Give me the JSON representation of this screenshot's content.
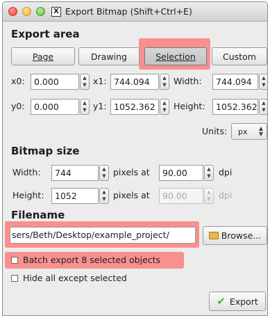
{
  "window": {
    "title": "Export Bitmap (Shift+Ctrl+E)"
  },
  "export_area": {
    "heading": "Export area",
    "buttons": [
      {
        "label": "Page",
        "pressed": false
      },
      {
        "label": "Drawing",
        "pressed": false
      },
      {
        "label": "Selection",
        "pressed": true
      },
      {
        "label": "Custom",
        "pressed": false
      }
    ],
    "x0_label": "x0:",
    "x0_value": "0.000",
    "x1_label": "x1:",
    "x1_value": "744.094",
    "width_label": "Width:",
    "width_value": "744.094",
    "y0_label": "y0:",
    "y0_value": "0.000",
    "y1_label": "y1:",
    "y1_value": "1052.362",
    "height_label": "Height:",
    "height_value": "1052.362",
    "units_label": "Units:",
    "units_value": "px"
  },
  "bitmap_size": {
    "heading": "Bitmap size",
    "width_label": "Width:",
    "width_value": "744",
    "height_label": "Height:",
    "height_value": "1052",
    "pixels_at": "pixels at",
    "dpi_value": "90.00",
    "dpi_value_disabled": "90.00",
    "dpi_label": "dpi"
  },
  "filename": {
    "heading": "Filename",
    "path": "sers/Beth/Desktop/example_project/",
    "browse_label": "Browse..."
  },
  "options": {
    "batch_export": "Batch export 8 selected objects",
    "hide_all": "Hide all except selected"
  },
  "export_button": "Export",
  "colors": {
    "highlight": "#ff6b6b",
    "dialog_bg": "#ececec",
    "check_green": "#4caf2a"
  }
}
